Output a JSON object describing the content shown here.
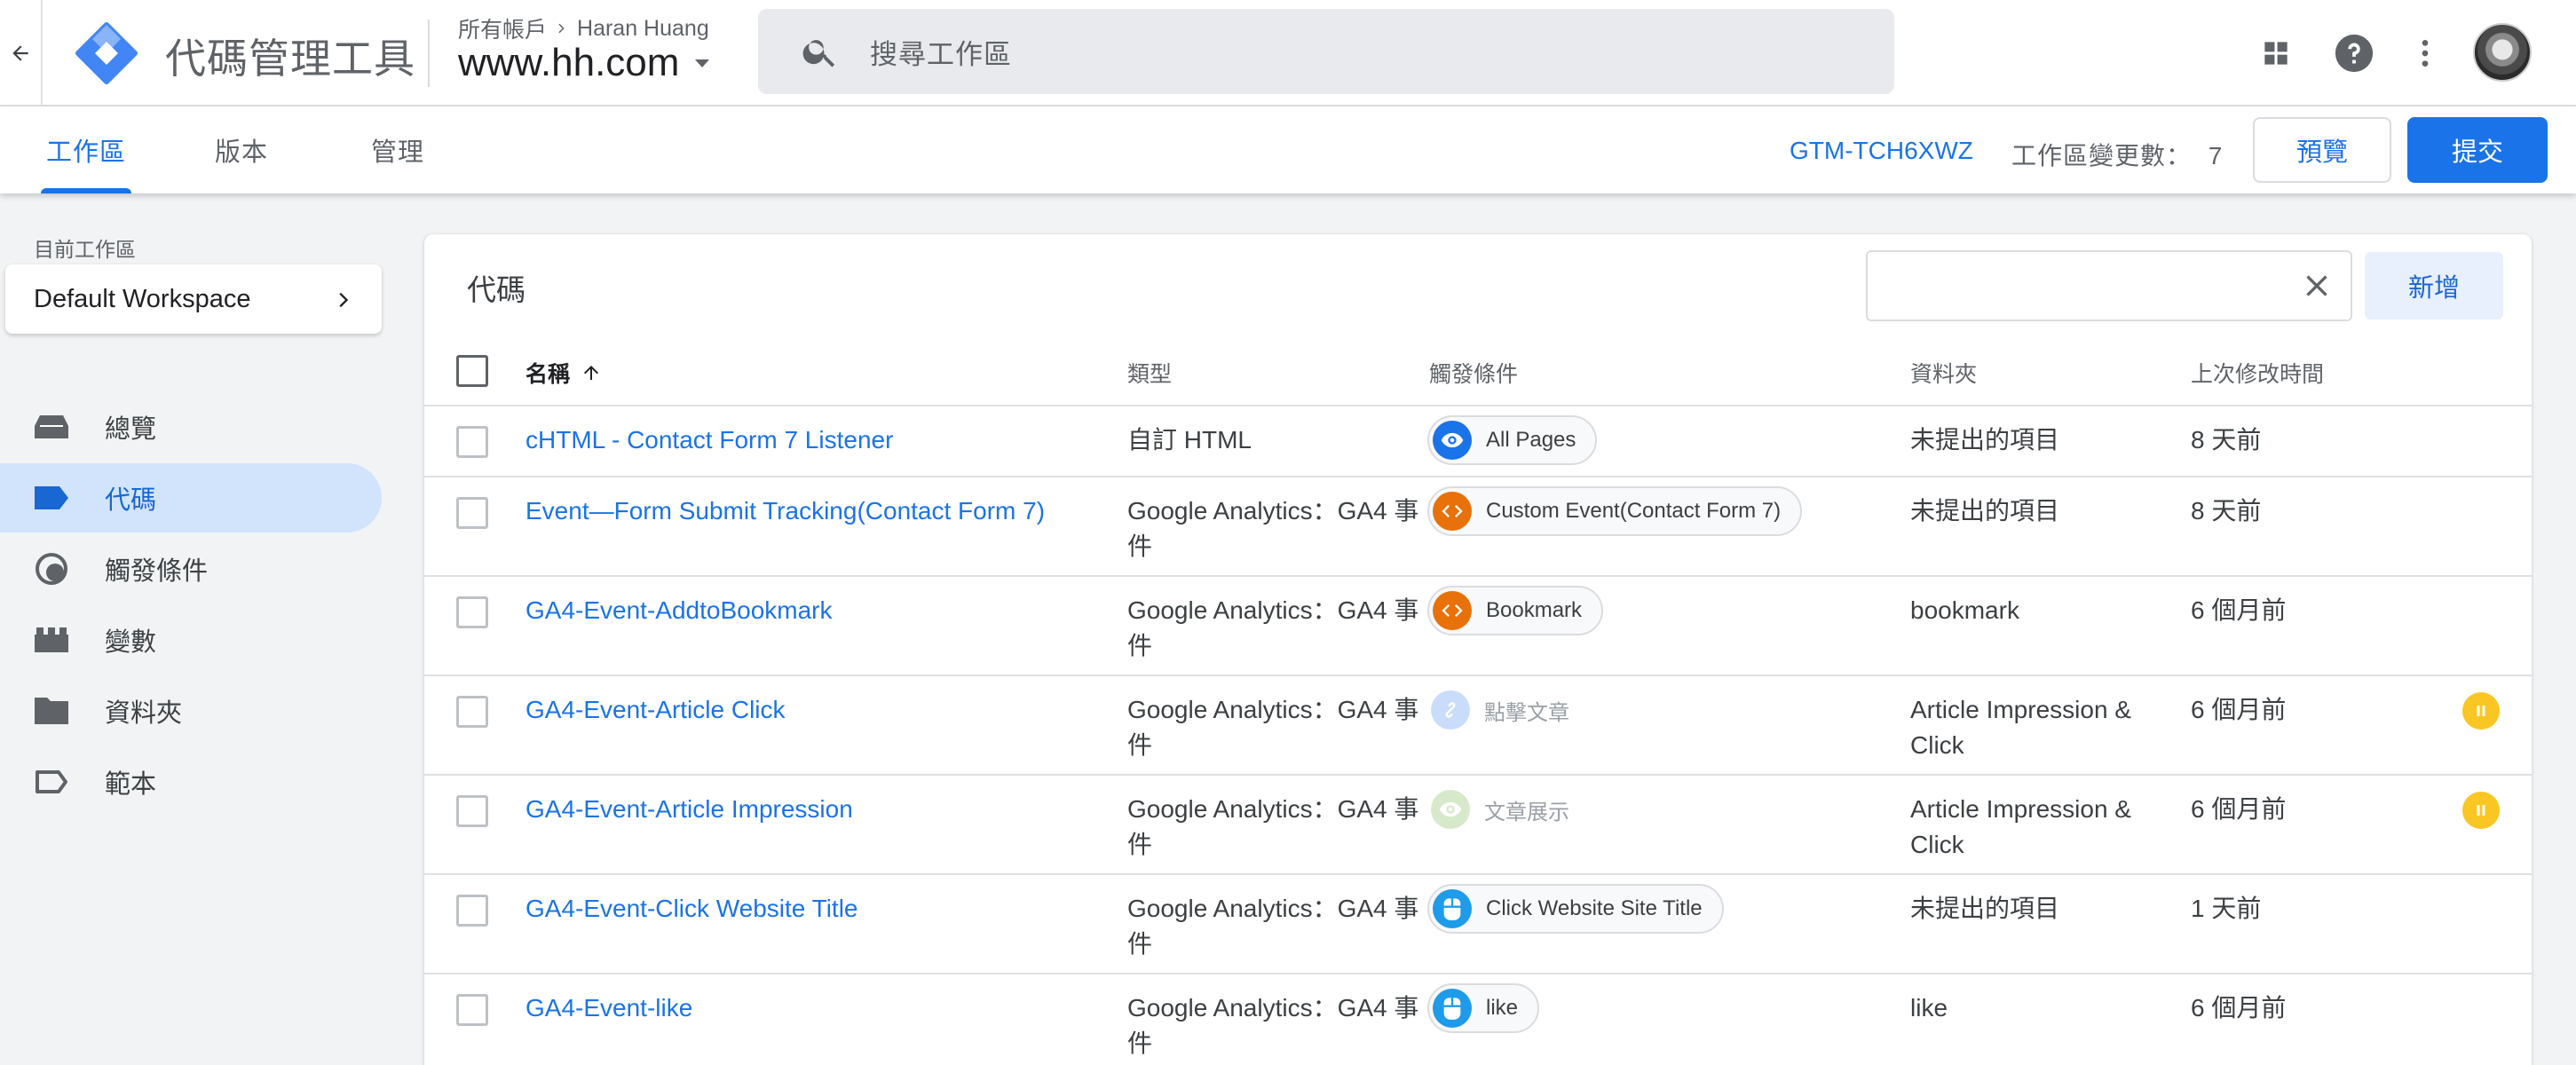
{
  "app": {
    "title": "代碼管理工具",
    "breadcrumb_accounts": "所有帳戶",
    "breadcrumb_account": "Haran Huang",
    "container": "www.hh.com",
    "search_placeholder": "搜尋工作區"
  },
  "tabs": [
    {
      "label": "工作區",
      "active": true
    },
    {
      "label": "版本",
      "active": false
    },
    {
      "label": "管理",
      "active": false
    }
  ],
  "header_right": {
    "container_id": "GTM-TCH6XWZ",
    "changes_label": "工作區變更數：",
    "changes_count": "7",
    "preview_label": "預覽",
    "submit_label": "提交"
  },
  "sidebar": {
    "workspace_label": "目前工作區",
    "workspace_name": "Default Workspace",
    "items": [
      {
        "label": "總覽",
        "icon": "overview-icon",
        "active": false
      },
      {
        "label": "代碼",
        "icon": "tag-icon",
        "active": true
      },
      {
        "label": "觸發條件",
        "icon": "trigger-icon",
        "active": false
      },
      {
        "label": "變數",
        "icon": "variables-icon",
        "active": false
      },
      {
        "label": "資料夾",
        "icon": "folder-icon",
        "active": false
      },
      {
        "label": "範本",
        "icon": "template-icon",
        "active": false
      }
    ]
  },
  "main": {
    "title": "代碼",
    "new_label": "新增",
    "columns": {
      "name": "名稱",
      "type": "類型",
      "trigger": "觸發條件",
      "folder": "資料夾",
      "modified": "上次修改時間"
    },
    "rows": [
      {
        "name": "cHTML - Contact Form 7 Listener",
        "type": "自訂 HTML",
        "trigger": "All Pages",
        "trigger_icon": "eye-icon",
        "trigger_color": "#1a73e8",
        "trigger_paused": false,
        "folder": "未提出的項目",
        "modified": "8 天前",
        "paused": false
      },
      {
        "name": "Event—Form Submit Tracking(Contact Form 7)",
        "type": "Google Analytics：GA4 事件",
        "trigger": "Custom Event(Contact Form 7)",
        "trigger_icon": "code-icon",
        "trigger_color": "#e8710a",
        "trigger_paused": false,
        "folder": "未提出的項目",
        "modified": "8 天前",
        "paused": false
      },
      {
        "name": "GA4-Event-AddtoBookmark",
        "type": "Google Analytics：GA4 事件",
        "trigger": "Bookmark",
        "trigger_icon": "code-icon",
        "trigger_color": "#e8710a",
        "trigger_paused": false,
        "folder": "bookmark",
        "modified": "6 個月前",
        "paused": false
      },
      {
        "name": "GA4-Event-Article Click",
        "type": "Google Analytics：GA4 事件",
        "trigger": "點擊文章",
        "trigger_icon": "link-icon",
        "trigger_color": "#8ab4f8",
        "trigger_paused": true,
        "folder": "Article Impression & Click",
        "modified": "6 個月前",
        "paused": true
      },
      {
        "name": "GA4-Event-Article Impression",
        "type": "Google Analytics：GA4 事件",
        "trigger": "文章展示",
        "trigger_icon": "eye-icon",
        "trigger_color": "#a8d08d",
        "trigger_paused": true,
        "folder": "Article Impression & Click",
        "modified": "6 個月前",
        "paused": true
      },
      {
        "name": "GA4-Event-Click Website Title",
        "type": "Google Analytics：GA4 事件",
        "trigger": "Click Website Site Title",
        "trigger_icon": "mouse-icon",
        "trigger_color": "#1e9be9",
        "trigger_paused": false,
        "folder": "未提出的項目",
        "modified": "1 天前",
        "paused": false
      },
      {
        "name": "GA4-Event-like",
        "type": "Google Analytics：GA4 事件",
        "trigger": "like",
        "trigger_icon": "mouse-icon",
        "trigger_color": "#1e9be9",
        "trigger_paused": false,
        "folder": "like",
        "modified": "6 個月前",
        "paused": false
      }
    ]
  },
  "colors": {
    "accent": "#1a73e8",
    "active_nav_bg": "#d2e3fc",
    "paused_badge": "#f9c623"
  }
}
